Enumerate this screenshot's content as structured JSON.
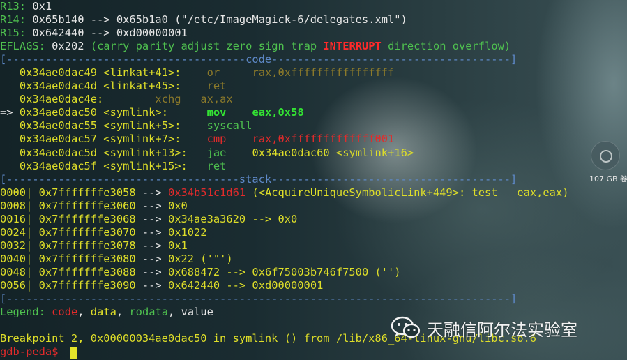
{
  "regs": [
    {
      "name": "R13:",
      "value": "0x1"
    },
    {
      "name": "R14:",
      "value": "0x65b140 --> 0x65b1a0 (\"/etc/ImageMagick-6/delegates.xml\")"
    },
    {
      "name": "R15:",
      "value": "0x642440 --> 0xd00000001"
    }
  ],
  "eflags": {
    "label": "EFLAGS:",
    "value": "0x202",
    "open": "(",
    "flags_before": "carry parity adjust zero sign trap",
    "flag_set": "INTERRUPT",
    "flags_after": "direction overflow",
    "close": ")"
  },
  "separators": {
    "code": "[-------------------------------------code-------------------------------------]",
    "stack": "[------------------------------------stack-------------------------------------]",
    "end": "[------------------------------------------------------------------------------]"
  },
  "code_lines": [
    {
      "prefix": "   ",
      "addr": "0x34ae0dac49",
      "sym": "<linkat+41>:",
      "gap": "    ",
      "mnem": "or",
      "pad": "     ",
      "ops": "rax,0xffffffffffffffff",
      "style": "dim"
    },
    {
      "prefix": "   ",
      "addr": "0x34ae0dac4d",
      "sym": "<linkat+45>:",
      "gap": "    ",
      "mnem": "ret",
      "pad": "",
      "ops": "",
      "style": "dim"
    },
    {
      "prefix": "   ",
      "addr": "0x34ae0dac4e:",
      "sym": "",
      "gap": "        ",
      "mnem": "xchg",
      "pad": "   ",
      "ops": "ax,ax",
      "style": "dim"
    },
    {
      "prefix": "=> ",
      "addr": "0x34ae0dac50",
      "sym": "<symlink>:",
      "gap": "      ",
      "mnem": "mov",
      "pad": "    ",
      "ops": "eax,0x58",
      "style": "current"
    },
    {
      "prefix": "   ",
      "addr": "0x34ae0dac55",
      "sym": "<symlink+5>:",
      "gap": "    ",
      "mnem": "syscall",
      "pad": "",
      "ops": "",
      "style": "next"
    },
    {
      "prefix": "   ",
      "addr": "0x34ae0dac57",
      "sym": "<symlink+7>:",
      "gap": "    ",
      "mnem": "cmp",
      "pad": "    ",
      "ops": "rax,0xfffffffffffff001",
      "style": "red"
    },
    {
      "prefix": "   ",
      "addr": "0x34ae0dac5d",
      "sym": "<symlink+13>:",
      "gap": "   ",
      "mnem": "jae",
      "pad": "    ",
      "ops": "0x34ae0dac60 <symlink+16>",
      "style": "next"
    },
    {
      "prefix": "   ",
      "addr": "0x34ae0dac5f",
      "sym": "<symlink+15>:",
      "gap": "   ",
      "mnem": "ret",
      "pad": "",
      "ops": "",
      "style": "next"
    }
  ],
  "stack_lines": [
    {
      "idx": "0000|",
      "addr": "0x7fffffffe3058",
      "rest_code": "0x34b51c1d61",
      "rest": " (<AcquireUniqueSymbolicLink+449>: test   eax,eax)"
    },
    {
      "idx": "0008|",
      "addr": "0x7fffffffe3060",
      "rest_code": "",
      "rest": "0x0"
    },
    {
      "idx": "0016|",
      "addr": "0x7fffffffe3068",
      "rest_code": "",
      "rest": "0x34ae3a3620 --> 0x0"
    },
    {
      "idx": "0024|",
      "addr": "0x7fffffffe3070",
      "rest_code": "",
      "rest": "0x1022"
    },
    {
      "idx": "0032|",
      "addr": "0x7fffffffe3078",
      "rest_code": "",
      "rest": "0x1"
    },
    {
      "idx": "0040|",
      "addr": "0x7fffffffe3080",
      "rest_code": "",
      "rest": "0x22 ('\"')"
    },
    {
      "idx": "0048|",
      "addr": "0x7fffffffe3088",
      "rest_code": "",
      "rest": "0x688472 --> 0x6f75003b746f7500 ('')"
    },
    {
      "idx": "0056|",
      "addr": "0x7fffffffe3090",
      "rest_code": "",
      "rest": "0x642440 --> 0xd00000001"
    }
  ],
  "arrow": " --> ",
  "legend": {
    "label": "Legend:",
    "code": "code",
    "data": "data",
    "rodata": "rodata",
    "value": "value",
    "sep": ", "
  },
  "breakpoint": "Breakpoint 2, 0x00000034ae0dac50 in symlink () from /lib/x86_64-linux-gnu/libc.so.6",
  "prompt": "gdb-peda$ ",
  "overlay": {
    "disk_label": "107 GB 卷",
    "watermark_text": "天融信阿尔法实验室"
  },
  "colors": {
    "register": "#dede29",
    "label": "#4fc14f",
    "interrupt": "#ff2a2a",
    "code": "#e22b2b",
    "current_instr": "#33e233",
    "cursor": "#e3e32a"
  }
}
